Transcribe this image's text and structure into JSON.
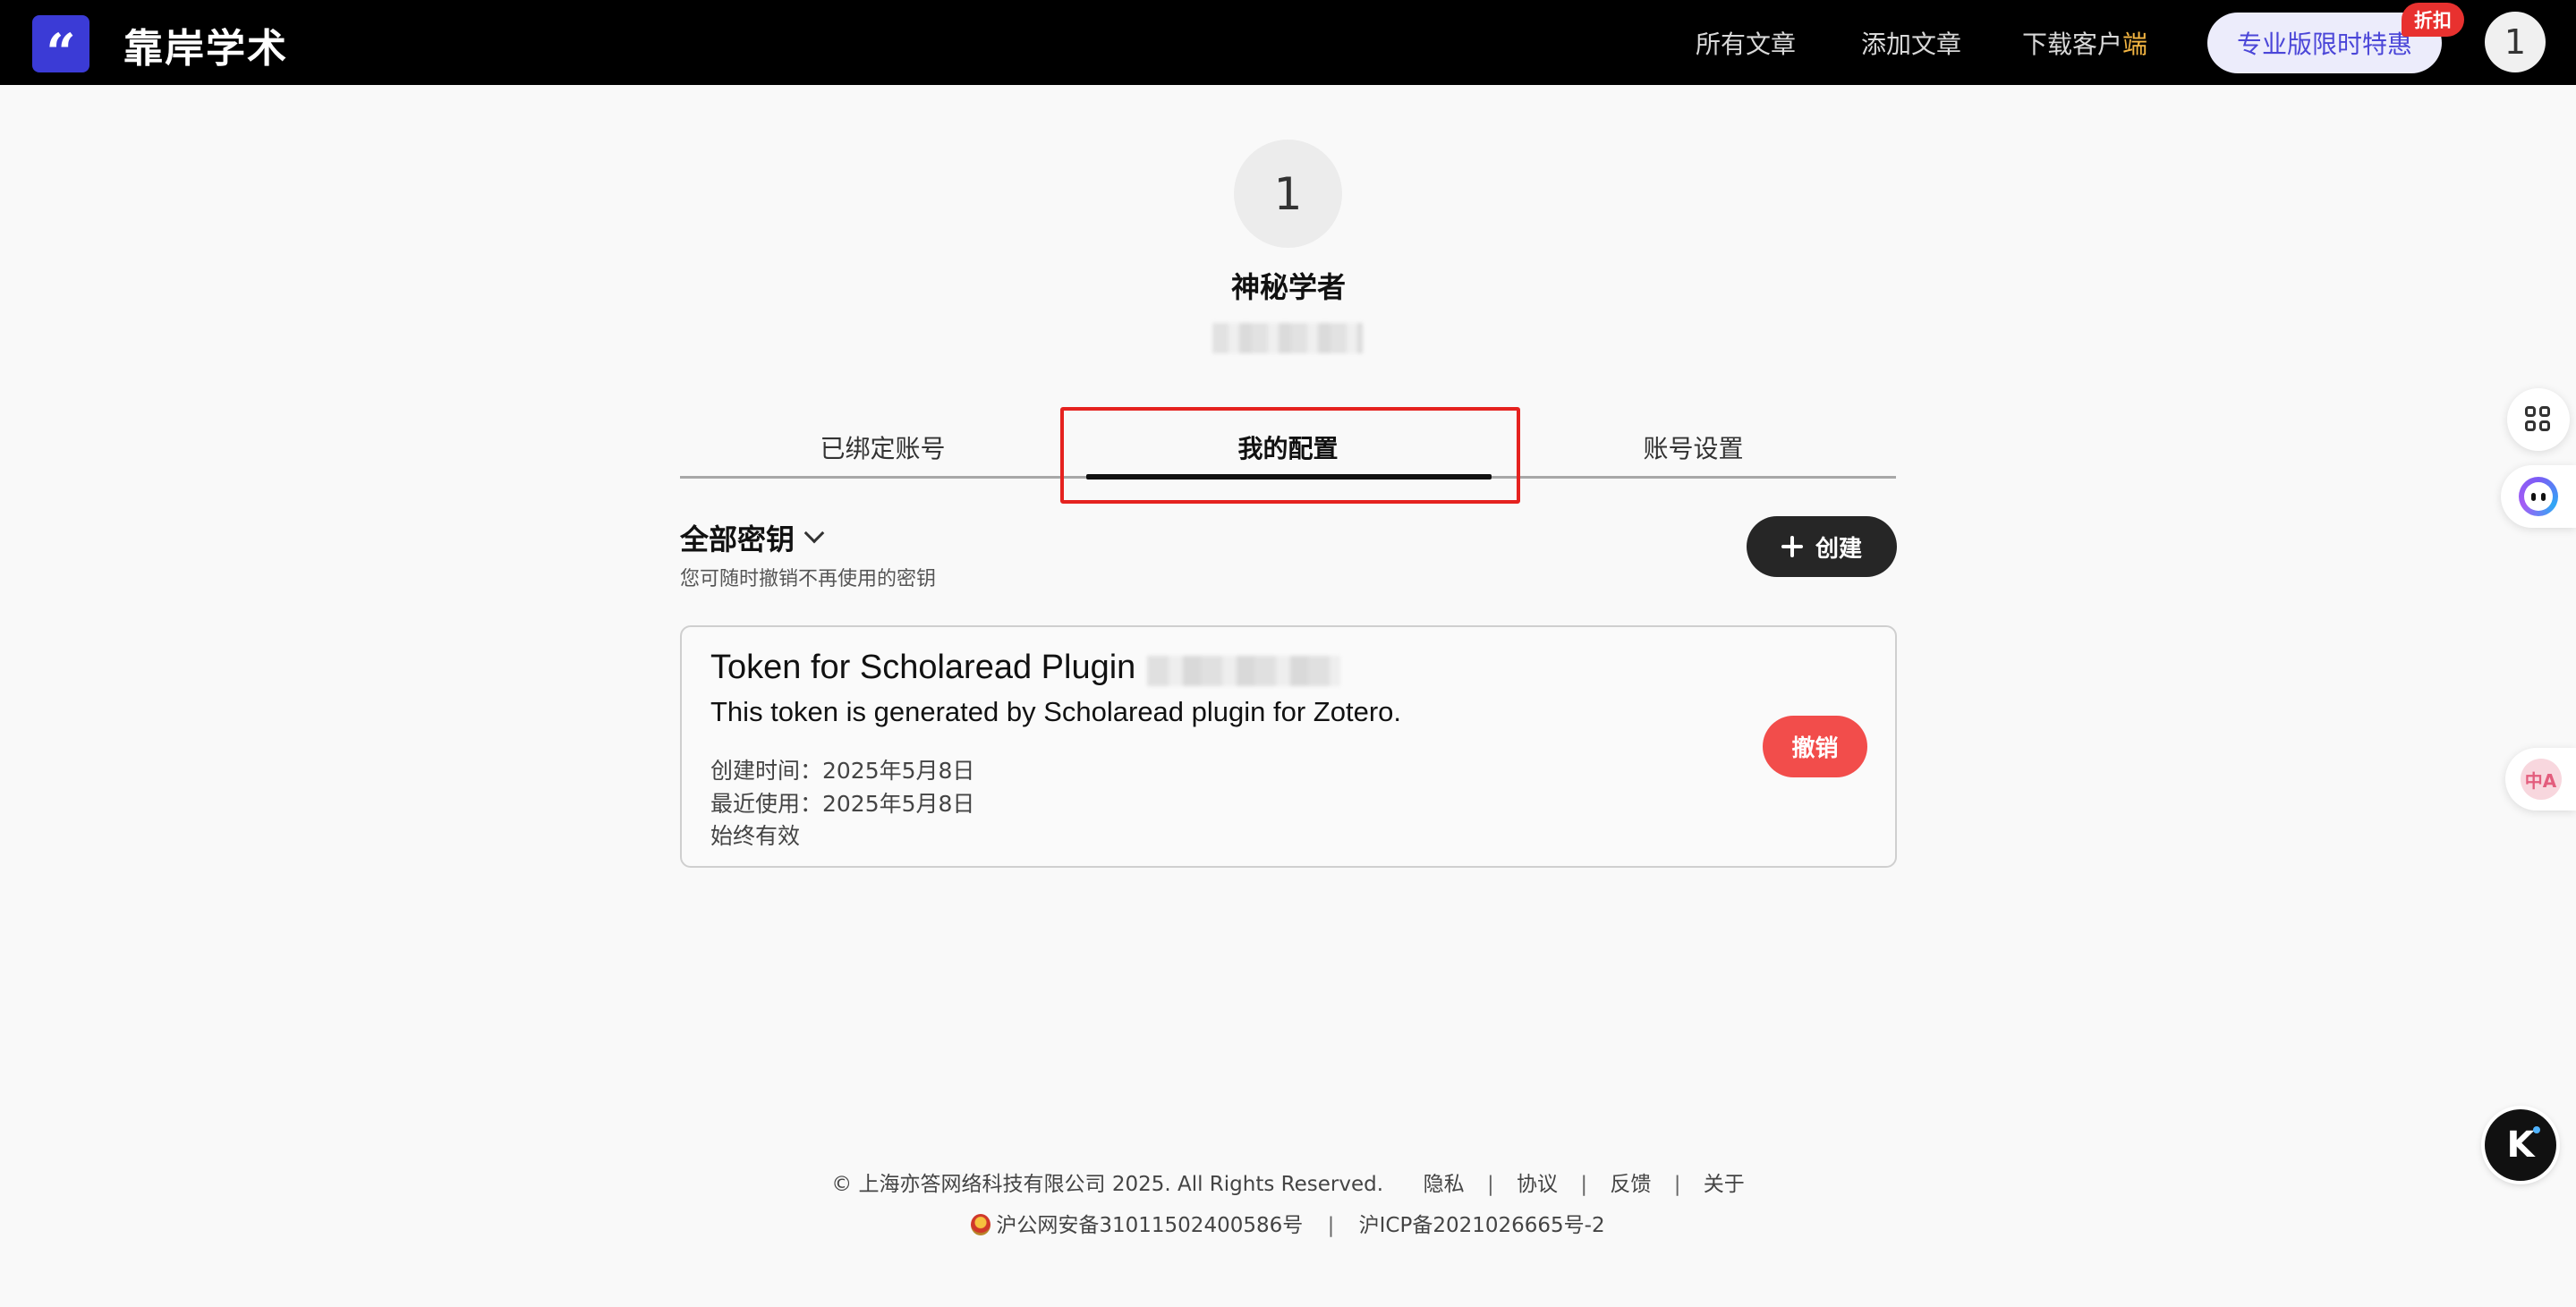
{
  "header": {
    "logo_glyph": "“",
    "brand": "靠岸学术",
    "nav": {
      "all_articles": "所有文章",
      "add_article": "添加文章",
      "download_client_prefix": "下载客户",
      "download_client_accent": "端"
    },
    "pro_button": "专业版限时特惠",
    "discount_badge": "折扣",
    "avatar_initial": "1"
  },
  "profile": {
    "avatar_initial": "1",
    "name": "神秘学者"
  },
  "tabs": [
    {
      "label": "已绑定账号",
      "active": false
    },
    {
      "label": "我的配置",
      "active": true
    },
    {
      "label": "账号设置",
      "active": false
    }
  ],
  "keys": {
    "title": "全部密钥",
    "hint": "您可随时撤销不再使用的密钥",
    "create_label": "创建"
  },
  "token": {
    "name": "Token for Scholaread Plugin",
    "description": "This token is generated by Scholaread plugin for Zotero.",
    "created": "创建时间：2025年5月8日",
    "last_used": "最近使用：2025年5月8日",
    "validity": "始终有效",
    "revoke_label": "撤销"
  },
  "sidebar": {
    "translate_label": "中A",
    "k_label": "K"
  },
  "footer": {
    "copyright": "© 上海亦答网络科技有限公司 2025. All Rights Reserved.",
    "links": [
      "隐私",
      "协议",
      "反馈",
      "关于"
    ],
    "police_record": "沪公网安备31011502400586号",
    "icp_record": "沪ICP备2021026665号-2"
  },
  "colors": {
    "accent": "#3b3bd6",
    "danger": "#f24d4b",
    "highlight": "#e5221f",
    "pro_text": "#4b46d8"
  }
}
